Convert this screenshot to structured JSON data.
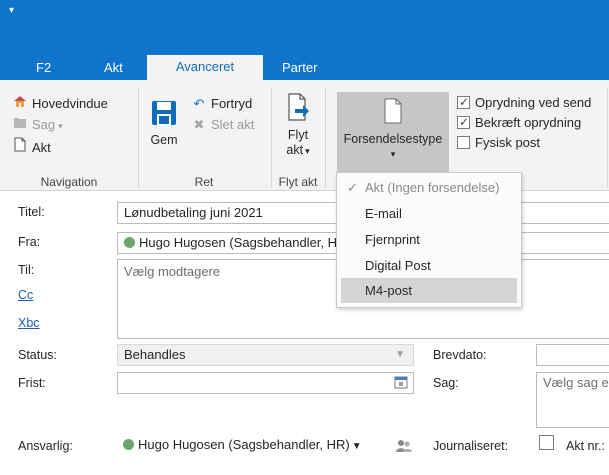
{
  "qat": {
    "icon": "dropdown-arrow-icon"
  },
  "tabs": [
    "F2",
    "Akt",
    "Avanceret",
    "Parter"
  ],
  "ribbon": {
    "navigation": {
      "hovedvindue": "Hovedvindue",
      "sag": "Sag",
      "akt": "Akt",
      "label": "Navigation"
    },
    "ret": {
      "gem": "Gem",
      "fortryd": "Fortryd",
      "slet_akt": "Slet akt",
      "label": "Ret"
    },
    "flyt": {
      "line1": "Flyt",
      "line2": "akt",
      "label": "Flyt akt"
    },
    "forsendelse": {
      "label": "Forsendelsestype"
    },
    "checks": [
      {
        "label": "Oprydning ved send",
        "checked": true
      },
      {
        "label": "Bekræft oprydning",
        "checked": true
      },
      {
        "label": "Fysisk post",
        "checked": false
      }
    ]
  },
  "dropdown": {
    "items": [
      {
        "label": "Akt (Ingen forsendelse)",
        "checked": true,
        "disabled": true
      },
      {
        "label": "E-mail"
      },
      {
        "label": "Fjernprint"
      },
      {
        "label": "Digital Post"
      },
      {
        "label": "M4-post",
        "hover": true
      }
    ]
  },
  "form": {
    "titel_label": "Titel:",
    "titel_value": "Lønudbetaling juni 2021",
    "fra_label": "Fra:",
    "fra_value": "Hugo Hugosen (Sagsbehandler, H",
    "til_label": "Til:",
    "til_placeholder": "Vælg modtagere",
    "cc_link": "Cc",
    "xbc_link": "Xbc",
    "status_label": "Status:",
    "status_value": "Behandles",
    "frist_label": "Frist:",
    "frist_value": "",
    "brevdato_label": "Brevdato:",
    "sag_label": "Sag:",
    "sag_placeholder": "Vælg sag e",
    "ansvarlig_label": "Ansvarlig:",
    "ansvarlig_value": "Hugo Hugosen (Sagsbehandler, HR)",
    "journaliseret_label": "Journaliseret:",
    "akt_nr_label": "Akt nr.:"
  }
}
